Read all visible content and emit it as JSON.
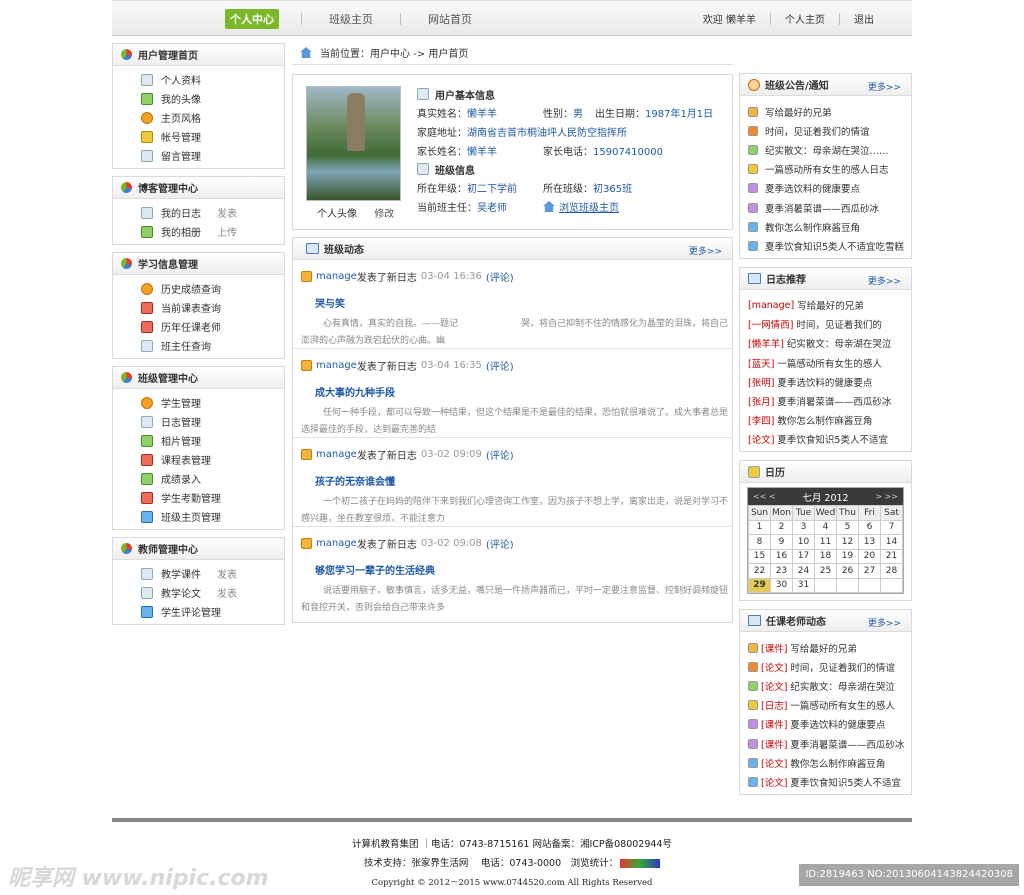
{
  "topnav": {
    "tabs": [
      "个人中心",
      "班级主页",
      "网站首页"
    ],
    "welcome": "欢迎",
    "user": "懒羊羊",
    "home": "个人主页",
    "logout": "退出"
  },
  "left": [
    {
      "title": "用户管理首页",
      "items": [
        {
          "label": "个人资料",
          "icon": "id-card-icon"
        },
        {
          "label": "我的头像",
          "icon": "image-icon"
        },
        {
          "label": "主页风格",
          "icon": "palette-icon"
        },
        {
          "label": "帐号管理",
          "icon": "lock-icon"
        },
        {
          "label": "留言管理",
          "icon": "mail-icon"
        }
      ]
    },
    {
      "title": "博客管理中心",
      "items": [
        {
          "label": "我的日志",
          "icon": "book-icon",
          "extra": "发表"
        },
        {
          "label": "我的相册",
          "icon": "picture-icon",
          "extra": "上传"
        }
      ]
    },
    {
      "title": "学习信息管理",
      "items": [
        {
          "label": "历史成绩查询",
          "icon": "bar-chart-icon"
        },
        {
          "label": "当前课表查询",
          "icon": "calendar-icon"
        },
        {
          "label": "历年任课老师",
          "icon": "calendar-icon"
        },
        {
          "label": "班主任查询",
          "icon": "id-card-icon"
        }
      ]
    },
    {
      "title": "班级管理中心",
      "items": [
        {
          "label": "学生管理",
          "icon": "bar-chart-icon"
        },
        {
          "label": "日志管理",
          "icon": "book-icon"
        },
        {
          "label": "相片管理",
          "icon": "picture-icon"
        },
        {
          "label": "课程表管理",
          "icon": "calendar-icon"
        },
        {
          "label": "成绩录入",
          "icon": "pencil-icon"
        },
        {
          "label": "学生考勤管理",
          "icon": "calendar-icon"
        },
        {
          "label": "班级主页管理",
          "icon": "house-icon"
        }
      ]
    },
    {
      "title": "教师管理中心",
      "items": [
        {
          "label": "教学课件",
          "icon": "book-icon",
          "extra": "发表"
        },
        {
          "label": "教学论文",
          "icon": "table-icon",
          "extra": "发表"
        },
        {
          "label": "学生评论管理",
          "icon": "globe-icon"
        }
      ]
    }
  ],
  "crumb": "当前位置：用户中心 -> 用户首页",
  "profile": {
    "photo_caption": "个人头像",
    "edit": "修改",
    "basic_title": "用户基本信息",
    "name_label": "真实姓名：",
    "name": "懒羊羊",
    "gender_label": "性别：",
    "gender": "男",
    "birth_label": "出生日期：",
    "birth": "1987年1月1日",
    "address_label": "家庭地址：",
    "address": "湖南省吉首市桐油坪人民防空指挥所",
    "parent_label": "家长姓名：",
    "parent": "懒羊羊",
    "phone_label": "家长电话：",
    "phone": "15907410000",
    "class_title": "班级信息",
    "grade_label": "所在年级：",
    "grade": "初二下学前",
    "cls_label": "所在班级：",
    "cls": "初365班",
    "teacher_label": "当前班主任：",
    "teacher": "吴老师",
    "browse": "浏览班级主页"
  },
  "news": {
    "title": "班级动态",
    "more": "更多>>",
    "entries": [
      {
        "user": "manage",
        "action": "发表了新日志",
        "time": "03-04 16:36",
        "comment": "(评论)",
        "title": "哭与笑",
        "desc": "心有真情，真实的自我。——题记　　　　　　　哭，将自己抑制不住的情感化为晶莹的泪珠，将自己澎湃的心声融为跌宕起伏的心曲。幽"
      },
      {
        "user": "manage",
        "action": "发表了新日志",
        "time": "03-04 16:35",
        "comment": "(评论)",
        "title": "成大事的九种手段",
        "desc": "任何一种手段，都可以导致一种结果，但这个结果是不是最佳的结果，恐怕就很难说了。成大事者总是选择最佳的手段，达到最完善的结"
      },
      {
        "user": "manage",
        "action": "发表了新日志",
        "time": "03-02 09:09",
        "comment": "(评论)",
        "title": "孩子的无奈谁会懂",
        "desc": "一个初二孩子在妈妈的陪伴下来到我们心理咨询工作室，因为孩子不想上学，离家出走，说是对学习不感兴趣，坐在教室很烦，不能注意力"
      },
      {
        "user": "manage",
        "action": "发表了新日志",
        "time": "03-02 09:08",
        "comment": "(评论)",
        "title": "够您学习一辈子的生活经典",
        "desc": "说话要用脑子，敏事慎言，话多无益，嘴只是一件扬声器而已，平时一定要注意监督、控制好调频旋钮和音控开关，否则会给自己带来许多"
      }
    ]
  },
  "notice": {
    "title": "班级公告/通知",
    "more": "更多>>",
    "items": [
      "写给最好的兄弟",
      "时间，见证着我们的情谊",
      "纪实散文：母亲湖在哭泣……",
      "一篇感动所有女生的感人日志",
      "夏季选饮料的健康要点",
      "夏季消暑菜谱——西瓜砂冰",
      "教你怎么制作麻酱豆角",
      "夏季饮食知识5类人不适宜吃雪糕"
    ],
    "colors": [
      "#f4b43a",
      "#f08a2a",
      "#8fd06a",
      "#f3c93b",
      "#c48ee4",
      "#c48ee4",
      "#68b4ea",
      "#68b4ea"
    ]
  },
  "blog": {
    "title": "日志推荐",
    "more": "更多>>",
    "items": [
      {
        "tag": "[manage]",
        "text": "写给最好的兄弟"
      },
      {
        "tag": "[一网情西]",
        "text": "时间，见证着我们的"
      },
      {
        "tag": "[懒羊羊]",
        "text": "纪实散文：母亲湖在哭泣"
      },
      {
        "tag": "[蓝天]",
        "text": "一篇感动所有女生的感人"
      },
      {
        "tag": "[张明]",
        "text": "夏季选饮料的健康要点"
      },
      {
        "tag": "[张月]",
        "text": "夏季消暑菜谱——西瓜砂冰"
      },
      {
        "tag": "[李四]",
        "text": "教你怎么制作麻酱豆角"
      },
      {
        "tag": "[论文]",
        "text": "夏季饮食知识5类人不适宜"
      }
    ]
  },
  "calendar": {
    "title": "日历",
    "prev": "<< <",
    "month": "七月",
    "year": "2012",
    "next": "> >>",
    "days": [
      "Sun",
      "Mon",
      "Tue",
      "Wed",
      "Thu",
      "Fri",
      "Sat"
    ],
    "weeks": [
      [
        "1",
        "2",
        "3",
        "4",
        "5",
        "6",
        "7"
      ],
      [
        "8",
        "9",
        "10",
        "11",
        "12",
        "13",
        "14"
      ],
      [
        "15",
        "16",
        "17",
        "18",
        "19",
        "20",
        "21"
      ],
      [
        "22",
        "23",
        "24",
        "25",
        "26",
        "27",
        "28"
      ],
      [
        "29",
        "30",
        "31",
        "",
        "",
        "",
        ""
      ]
    ],
    "today": "29"
  },
  "teachers": {
    "title": "任课老师动态",
    "more": "更多>>",
    "items": [
      {
        "tag": "[课件]",
        "text": "写给最好的兄弟",
        "color": "#f4b43a"
      },
      {
        "tag": "[论文]",
        "text": "时间，见证着我们的情谊",
        "color": "#f08a2a"
      },
      {
        "tag": "[论文]",
        "text": "纪实散文：母亲湖在哭泣",
        "color": "#8fd06a"
      },
      {
        "tag": "[日志]",
        "text": "一篇感动所有女生的感人",
        "color": "#f3c93b"
      },
      {
        "tag": "[课件]",
        "text": "夏季选饮料的健康要点",
        "color": "#c48ee4"
      },
      {
        "tag": "[课件]",
        "text": "夏季消暑菜谱——西瓜砂冰",
        "color": "#c48ee4"
      },
      {
        "tag": "[论文]",
        "text": "教你怎么制作麻酱豆角",
        "color": "#68b4ea"
      },
      {
        "tag": "[论文]",
        "text": "夏季饮食知识5类人不适宜",
        "color": "#68b4ea"
      }
    ]
  },
  "footer": {
    "line1": "计算机教育集团 ｜电话：0743-8715161 网站备案：湘ICP备08002944号",
    "line2": "技术支持：张家界生活网　 电话：0743-0000　浏览统计：",
    "line3": "Copyright © 2012－2015 www.0744520.com All Rights Reserved"
  },
  "watermark": {
    "left": "昵享网 www.nipic.com",
    "right": "ID:2819463 NO:20130604143824420308"
  }
}
